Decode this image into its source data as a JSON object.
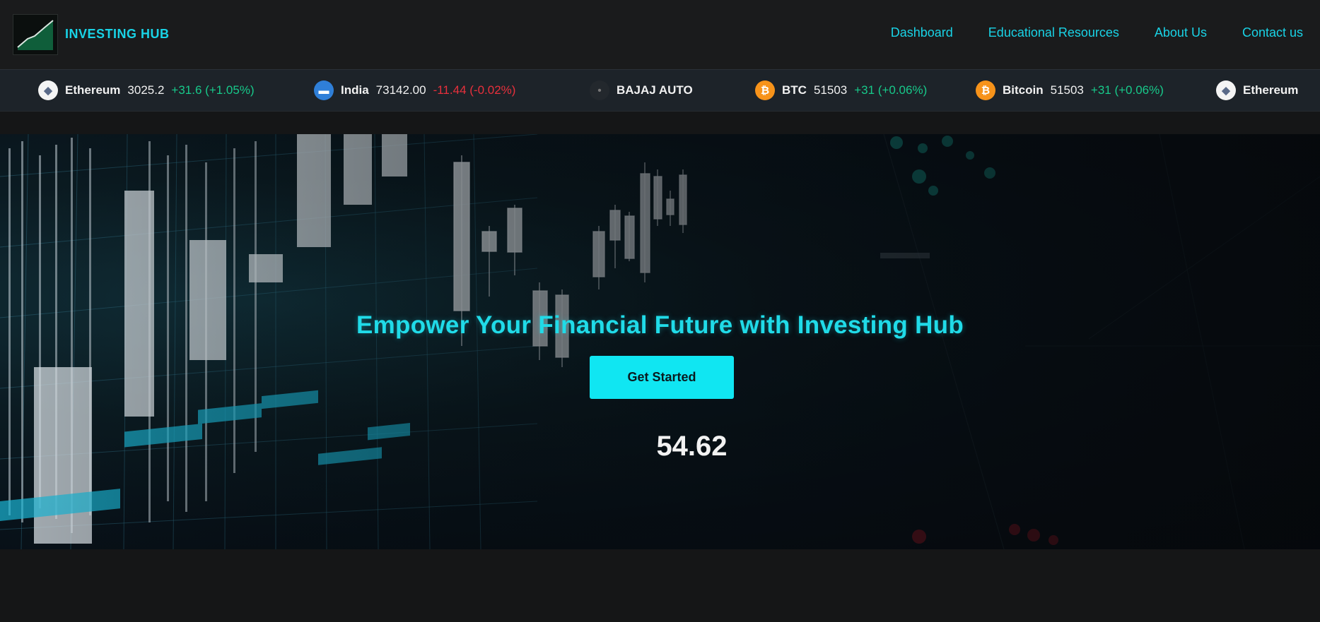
{
  "brand": {
    "name": "INVESTING HUB",
    "logo": "chart-logo-icon"
  },
  "nav": [
    {
      "label": "Dashboard"
    },
    {
      "label": "Educational Resources"
    },
    {
      "label": "About Us"
    },
    {
      "label": "Contact us"
    }
  ],
  "ticker": [
    {
      "icon": "ethereum-icon",
      "name": "Ethereum",
      "price": "3025.2",
      "change": "+31.6 (+1.05%)",
      "direction": "up"
    },
    {
      "icon": "india-icon",
      "name": "India",
      "price": "73142.00",
      "change": "-11.44 (-0.02%)",
      "direction": "down"
    },
    {
      "icon": "bajaj-icon",
      "name": "BAJAJ AUTO",
      "price": "",
      "change": "",
      "direction": "neutral"
    },
    {
      "icon": "bitcoin-icon",
      "name": "BTC",
      "price": "51503",
      "change": "+31 (+0.06%)",
      "direction": "up"
    },
    {
      "icon": "bitcoin-icon",
      "name": "Bitcoin",
      "price": "51503",
      "change": "+31 (+0.06%)",
      "direction": "up"
    },
    {
      "icon": "ethereum-icon",
      "name": "Ethereum",
      "price": "",
      "change": "",
      "direction": "neutral"
    }
  ],
  "hero": {
    "title": "Empower Your Financial Future with Investing Hub",
    "cta_label": "Get Started",
    "counter": "54.62"
  },
  "colors": {
    "accent": "#19d3e6",
    "button": "#10e6f2",
    "up": "#17c98a",
    "down": "#e8303c",
    "bitcoin": "#f7931a"
  }
}
